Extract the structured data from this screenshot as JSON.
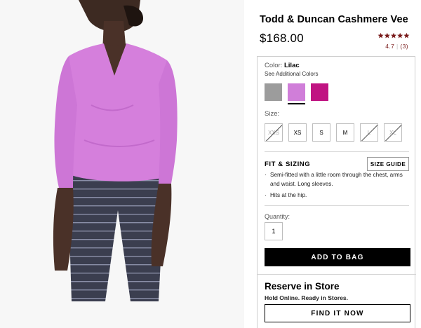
{
  "product": {
    "title": "Todd & Duncan Cashmere Vee",
    "price": "$168.00",
    "rating": 4.7,
    "rating_text": "4.7",
    "review_count_text": "(3)",
    "rating_color": "#7a1c1c"
  },
  "color": {
    "label": "Color:",
    "selected": "Lilac",
    "see_more": "See Additional Colors",
    "swatches": [
      {
        "name": "gray",
        "hex": "#9c9c9c",
        "selected": false
      },
      {
        "name": "lilac",
        "hex": "#d07ed9",
        "selected": true
      },
      {
        "name": "magenta",
        "hex": "#c01482",
        "selected": false
      }
    ]
  },
  "size": {
    "label": "Size:",
    "options": [
      {
        "label": "XXS",
        "available": false
      },
      {
        "label": "XS",
        "available": true
      },
      {
        "label": "S",
        "available": true
      },
      {
        "label": "M",
        "available": true
      },
      {
        "label": "L",
        "available": false
      },
      {
        "label": "XL",
        "available": false
      }
    ]
  },
  "fit": {
    "title": "FIT & SIZING",
    "size_guide_label": "SIZE GUIDE",
    "bullets": [
      "Semi-fitted with a little room through the chest, arms and waist. Long sleeves.",
      "Hits at the hip."
    ]
  },
  "quantity": {
    "label": "Quantity:",
    "value": "1"
  },
  "actions": {
    "add_to_bag": "ADD TO BAG"
  },
  "reserve": {
    "title": "Reserve in Store",
    "subtitle": "Hold Online. Ready in Stores.",
    "button": "FIND IT NOW"
  },
  "image": {
    "sweater_color": "#d57fdc",
    "pants_color": "#3a3d4d"
  }
}
